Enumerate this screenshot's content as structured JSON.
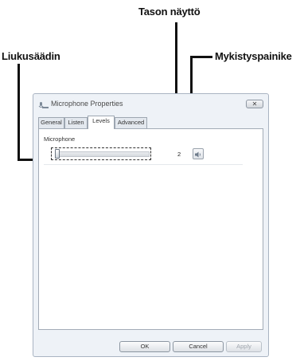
{
  "callouts": {
    "slider": "Liukusäädin",
    "level_display": "Tason näyttö",
    "mute_button": "Mykistyspainike"
  },
  "dialog": {
    "title": "Microphone Properties",
    "close_glyph": "✕",
    "tabs": [
      {
        "label": "General",
        "active": false
      },
      {
        "label": "Listen",
        "active": false
      },
      {
        "label": "Levels",
        "active": true
      },
      {
        "label": "Advanced",
        "active": false
      }
    ],
    "levels": {
      "device_label": "Microphone",
      "level_value": "2",
      "slider_level": 0.02,
      "mute_icon": "speaker-icon"
    },
    "buttons": {
      "ok": "OK",
      "cancel": "Cancel",
      "apply": "Apply",
      "apply_disabled": true
    }
  }
}
